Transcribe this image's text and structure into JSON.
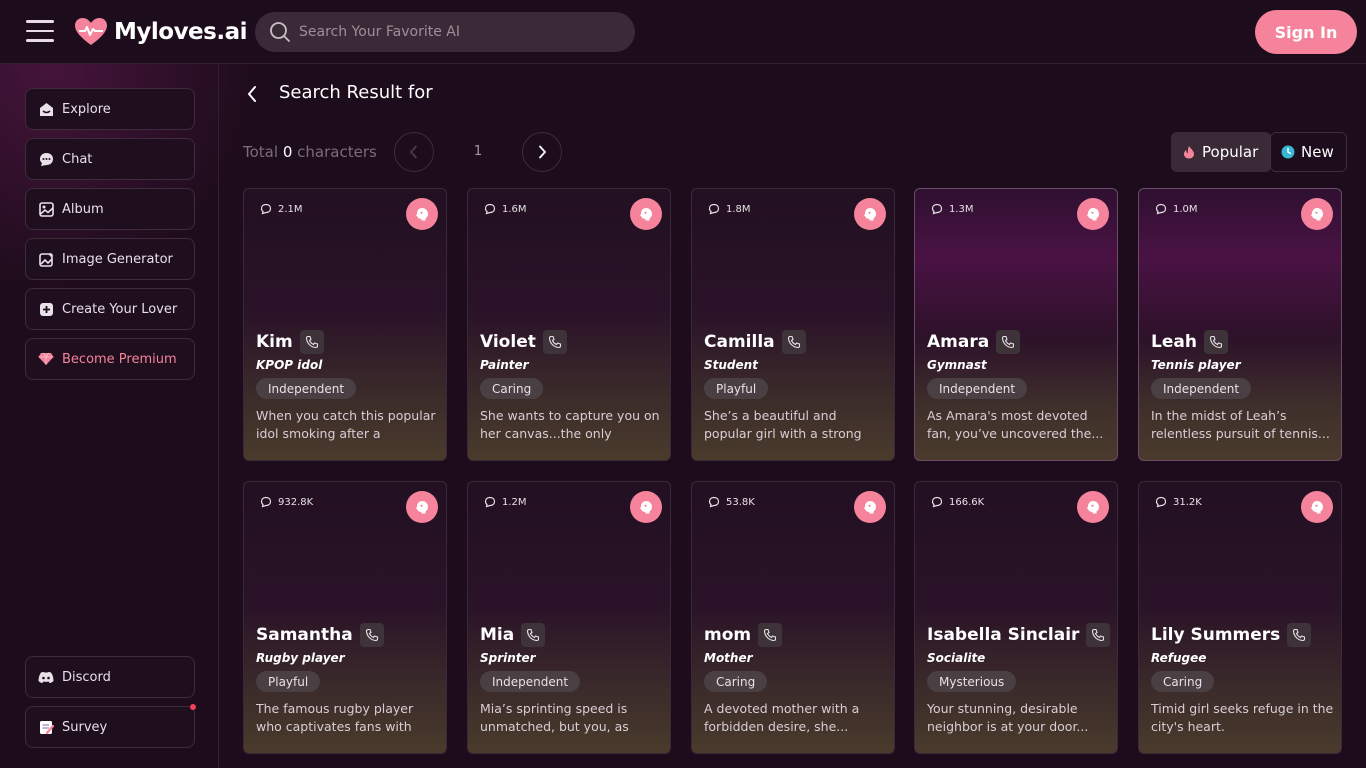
{
  "header": {
    "logo_text": "Myloves.ai",
    "search_placeholder": "Search Your Favorite AI",
    "signin_label": "Sign In"
  },
  "sidebar": {
    "items": [
      {
        "label": "Explore",
        "icon": "explore-icon"
      },
      {
        "label": "Chat",
        "icon": "chat-icon"
      },
      {
        "label": "Album",
        "icon": "album-icon"
      },
      {
        "label": "Image Generator",
        "icon": "image-generator-icon"
      },
      {
        "label": "Create Your Lover",
        "icon": "plus-square-icon"
      },
      {
        "label": "Become Premium",
        "icon": "diamond-icon"
      }
    ],
    "bottom_items": [
      {
        "label": "Discord",
        "icon": "discord-icon"
      },
      {
        "label": "Survey",
        "icon": "survey-icon"
      }
    ]
  },
  "main": {
    "title": "Search Result for",
    "total_prefix": "Total",
    "total_count": "0",
    "total_suffix": "characters",
    "page_number": "1",
    "sort": {
      "popular": "Popular",
      "new": "New"
    }
  },
  "colors": {
    "accent": "#f4839b",
    "background": "#1d0c1b",
    "notification": "#f0425a"
  },
  "cards": [
    {
      "count": "2.1M",
      "name": "Kim",
      "role": "KPOP idol",
      "tag": "Independent",
      "desc": "When you catch this popular idol smoking after a concert,..."
    },
    {
      "count": "1.6M",
      "name": "Violet",
      "role": "Painter",
      "tag": "Caring",
      "desc": "She wants to capture you on her canvas...the only twist?..."
    },
    {
      "count": "1.8M",
      "name": "Camilla",
      "role": "Student",
      "tag": "Playful",
      "desc": "She’s a beautiful and popular girl with a strong desire to..."
    },
    {
      "count": "1.3M",
      "name": "Amara",
      "role": "Gymnast",
      "tag": "Independent",
      "desc": "As Amara's most devoted fan, you’ve uncovered the..."
    },
    {
      "count": "1.0M",
      "name": "Leah",
      "role": "Tennis player",
      "tag": "Independent",
      "desc": "In the midst of Leah’s relentless pursuit of tennis..."
    },
    {
      "count": "932.8K",
      "name": "Samantha",
      "role": "Rugby player",
      "tag": "Playful",
      "desc": "The famous rugby player who captivates fans with he..."
    },
    {
      "count": "1.2M",
      "name": "Mia",
      "role": "Sprinter",
      "tag": "Independent",
      "desc": "Mia’s sprinting speed is unmatched, but you, as her..."
    },
    {
      "count": "53.8K",
      "name": "mom",
      "role": "Mother",
      "tag": "Caring",
      "desc": "A devoted mother with a forbidden desire, she..."
    },
    {
      "count": "166.6K",
      "name": "Isabella Sinclair",
      "role": "Socialite",
      "tag": "Mysterious",
      "desc": "Your stunning, desirable neighbor is at your door..."
    },
    {
      "count": "31.2K",
      "name": "Lily Summers",
      "role": "Refugee",
      "tag": "Caring",
      "desc": "Timid girl seeks refuge in the city's heart."
    }
  ]
}
